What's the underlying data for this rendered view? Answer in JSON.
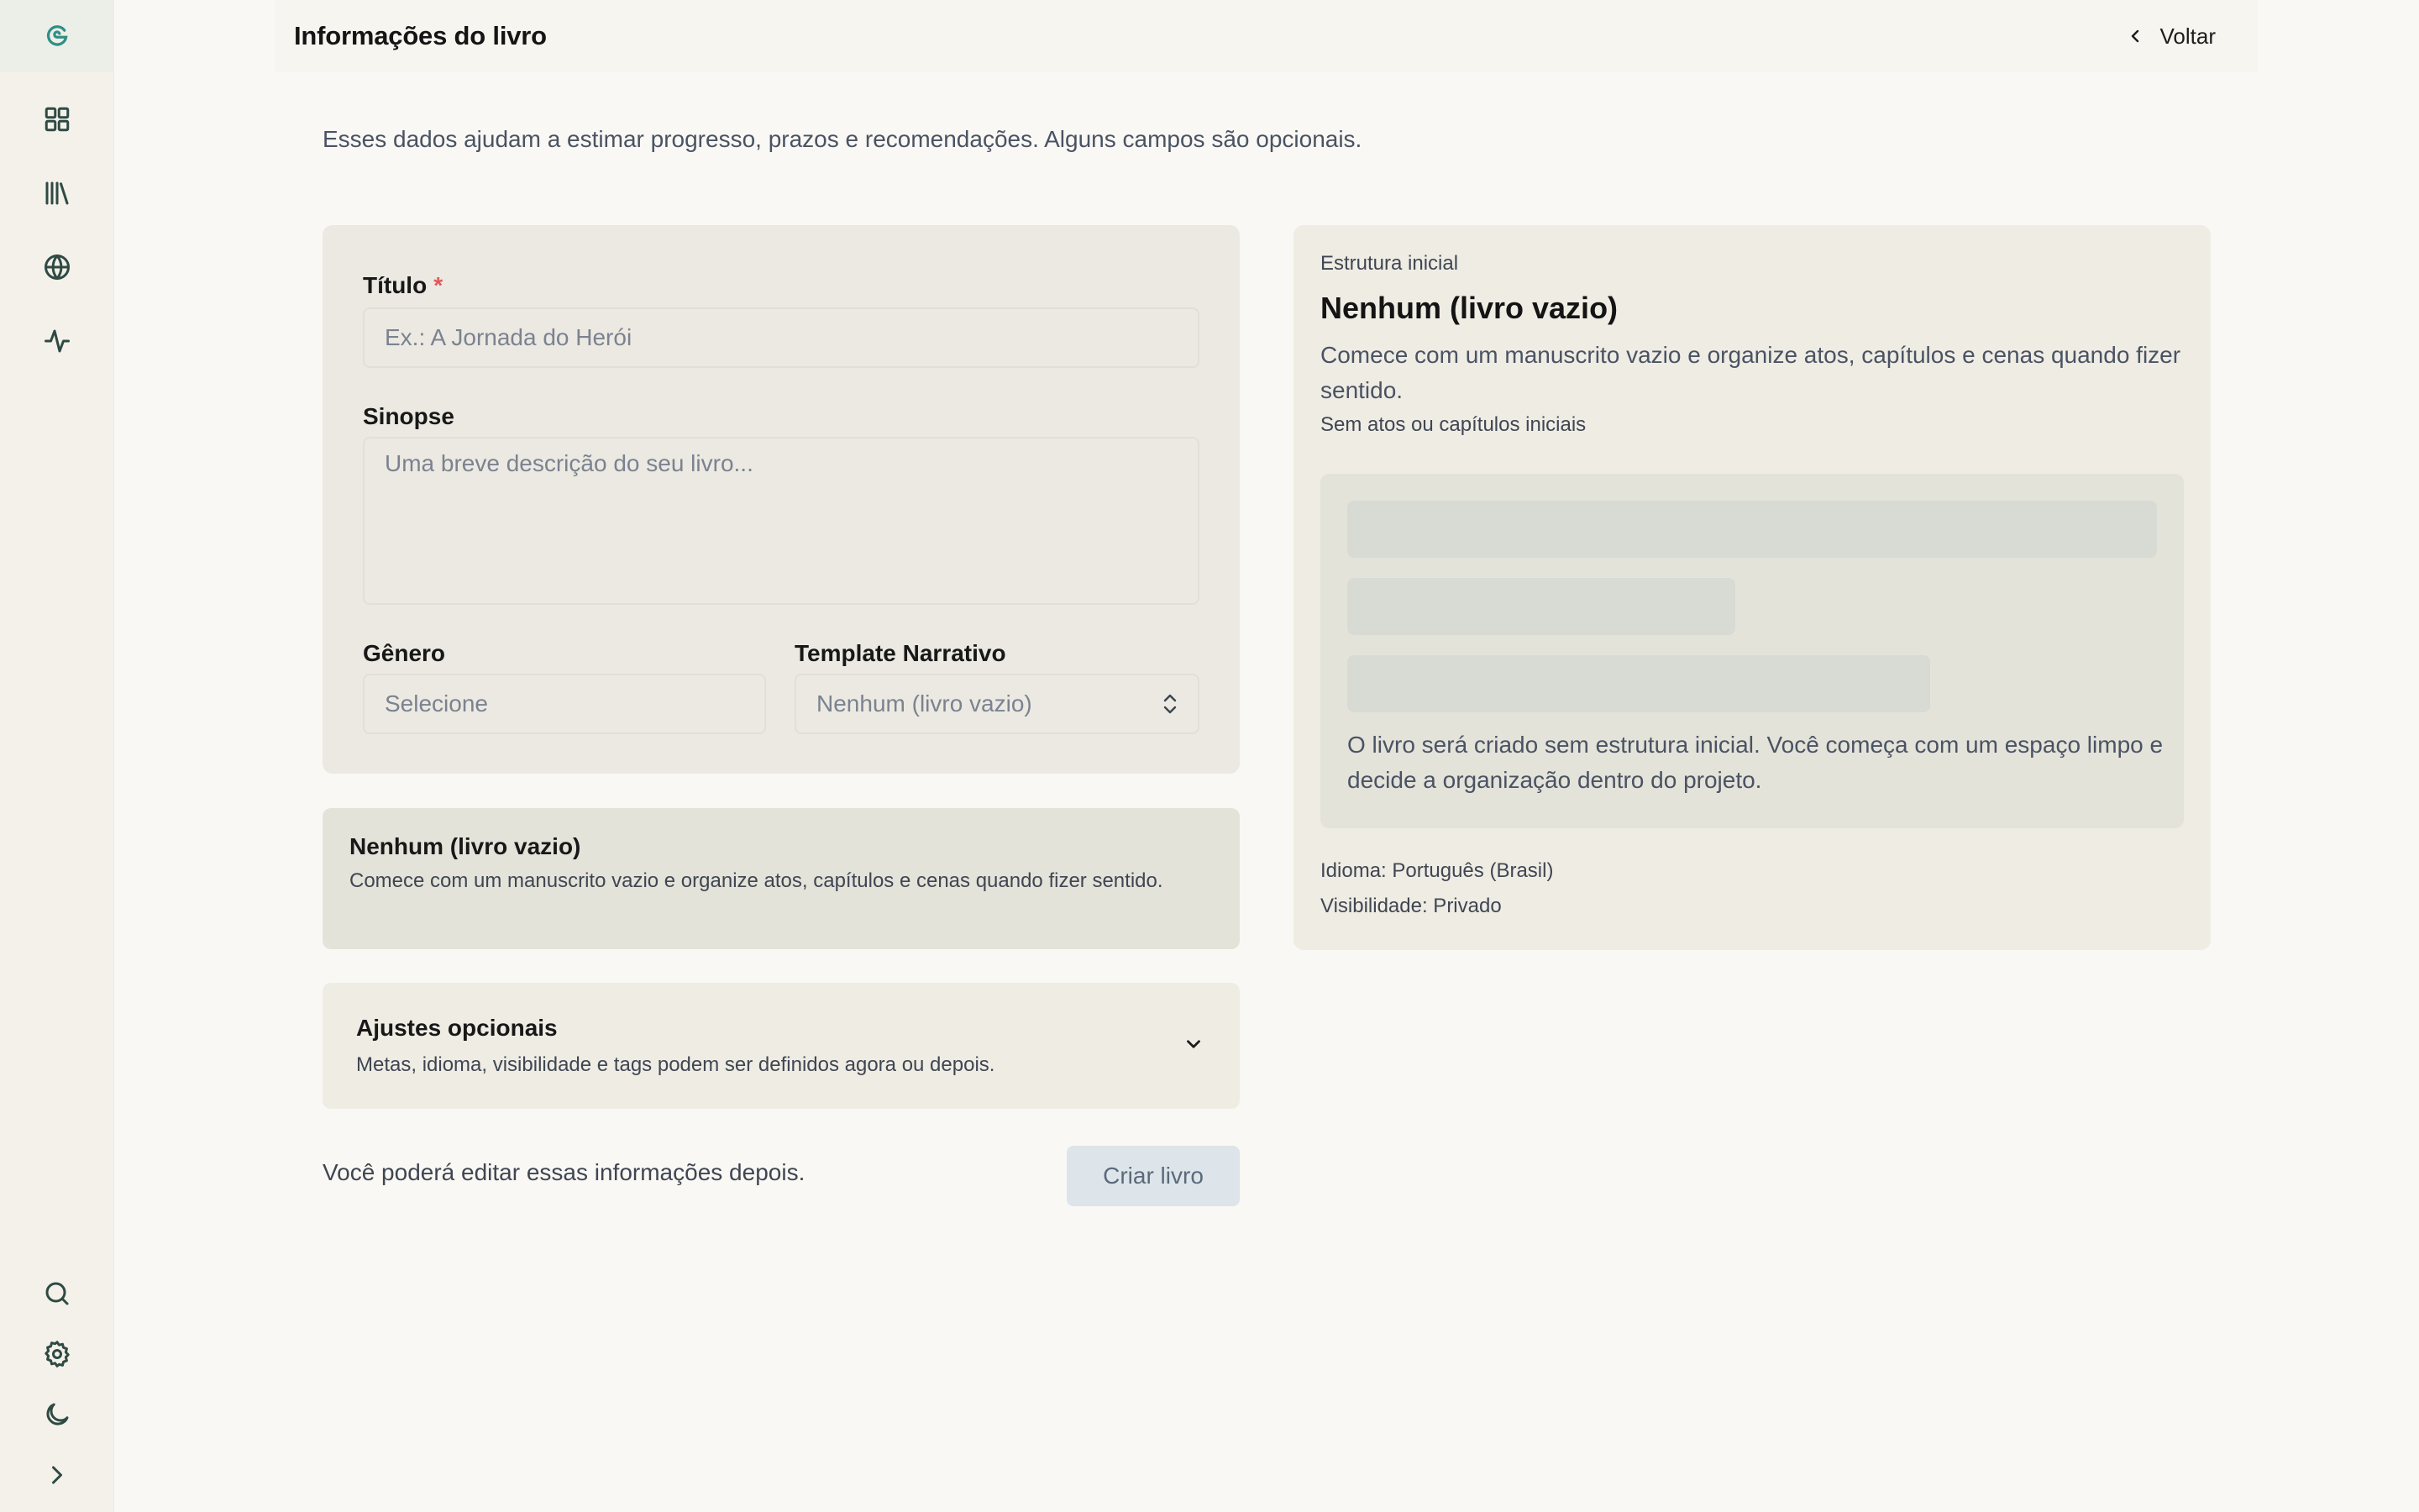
{
  "sidebar": {
    "logo_icon": "spiral-logo-icon",
    "nav": [
      {
        "icon": "grid-icon"
      },
      {
        "icon": "library-icon"
      },
      {
        "icon": "globe-icon"
      },
      {
        "icon": "activity-icon"
      }
    ],
    "bottom": [
      {
        "icon": "search-icon"
      },
      {
        "icon": "gear-icon"
      },
      {
        "icon": "moon-icon"
      },
      {
        "icon": "chevron-right-icon"
      }
    ],
    "accent": "#2f8f86"
  },
  "header": {
    "title": "Informações do livro",
    "back_label": "Voltar"
  },
  "intro": "Esses dados ajudam a estimar progresso, prazos e recomendações. Alguns campos são opcionais.",
  "form": {
    "title_label": "Título",
    "title_required": "*",
    "title_placeholder": "Ex.: A Jornada do Herói",
    "synopsis_label": "Sinopse",
    "synopsis_placeholder": "Uma breve descrição do seu livro...",
    "genre_label": "Gênero",
    "genre_value": "Selecione",
    "template_label": "Template Narrativo",
    "template_value": "Nenhum (livro vazio)"
  },
  "template_info": {
    "name": "Nenhum (livro vazio)",
    "description": "Comece com um manuscrito vazio e organize atos, capítulos e cenas quando fizer sentido."
  },
  "optional": {
    "title": "Ajustes opcionais",
    "description": "Metas, idioma, visibilidade e tags podem ser definidos agora ou depois."
  },
  "footer": {
    "note": "Você poderá editar essas informações depois.",
    "create_label": "Criar livro"
  },
  "preview": {
    "kicker": "Estrutura inicial",
    "title": "Nenhum (livro vazio)",
    "description": "Comece com um manuscrito vazio e organize atos, capítulos e cenas quando fizer sentido.",
    "subtitle": "Sem atos ou capítulos iniciais",
    "note": "O livro será criado sem estrutura inicial. Você começa com um espaço limpo e decide a organização dentro do projeto.",
    "language": "Idioma: Português (Brasil)",
    "visibility": "Visibilidade: Privado"
  }
}
